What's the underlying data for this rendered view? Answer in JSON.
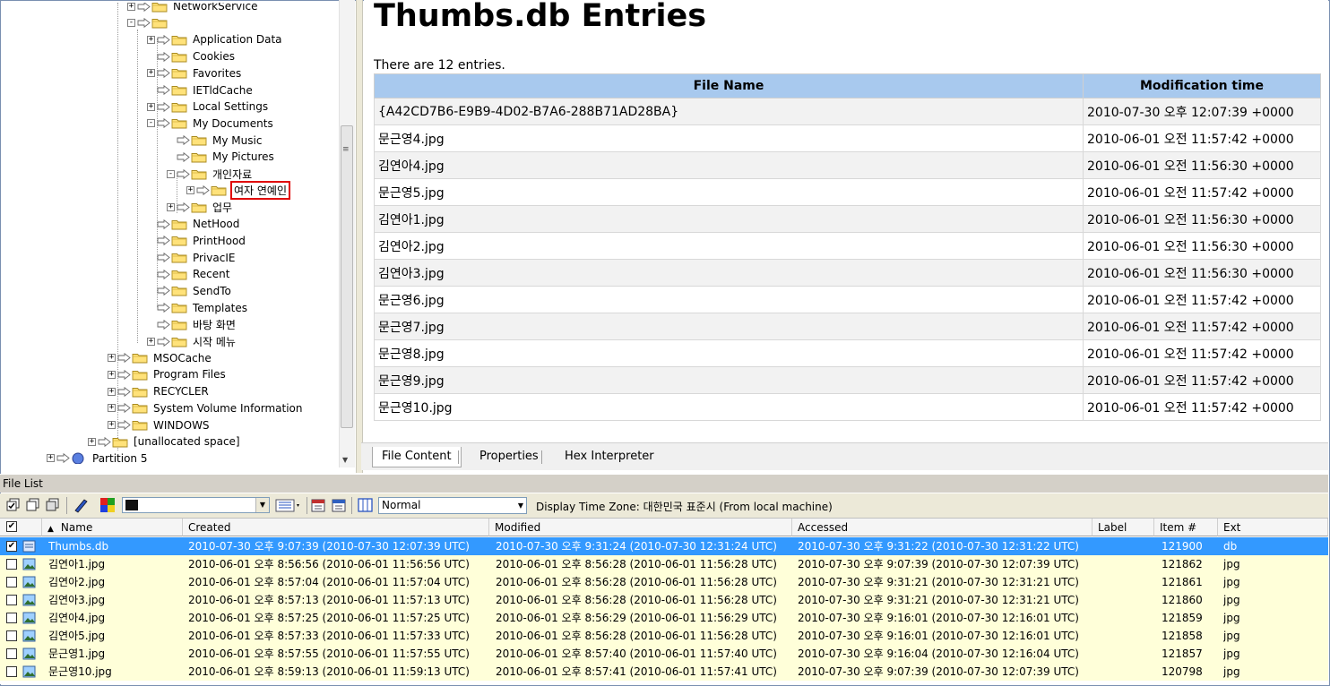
{
  "tree": {
    "items": [
      {
        "label": "NetworkService",
        "indent": 0,
        "expander": "+"
      },
      {
        "label": "",
        "indent": 0,
        "expander": "-"
      },
      {
        "label": "Application Data",
        "indent": 1,
        "expander": "+"
      },
      {
        "label": "Cookies",
        "indent": 1,
        "expander": ""
      },
      {
        "label": "Favorites",
        "indent": 1,
        "expander": "+"
      },
      {
        "label": "IETldCache",
        "indent": 1,
        "expander": ""
      },
      {
        "label": "Local Settings",
        "indent": 1,
        "expander": "+"
      },
      {
        "label": "My Documents",
        "indent": 1,
        "expander": "-"
      },
      {
        "label": "My Music",
        "indent": 2,
        "expander": ""
      },
      {
        "label": "My Pictures",
        "indent": 2,
        "expander": ""
      },
      {
        "label": "개인자료",
        "indent": 2,
        "expander": "-"
      },
      {
        "label": "여자 연예인",
        "indent": 3,
        "expander": "+",
        "selected": true
      },
      {
        "label": "업무",
        "indent": 2,
        "expander": "+"
      },
      {
        "label": "NetHood",
        "indent": 1,
        "expander": ""
      },
      {
        "label": "PrintHood",
        "indent": 1,
        "expander": ""
      },
      {
        "label": "PrivacIE",
        "indent": 1,
        "expander": ""
      },
      {
        "label": "Recent",
        "indent": 1,
        "expander": ""
      },
      {
        "label": "SendTo",
        "indent": 1,
        "expander": ""
      },
      {
        "label": "Templates",
        "indent": 1,
        "expander": ""
      },
      {
        "label": "바탕 화면",
        "indent": 1,
        "expander": ""
      },
      {
        "label": "시작 메뉴",
        "indent": 1,
        "expander": "+"
      },
      {
        "label": "MSOCache",
        "indent": -1,
        "expander": "+"
      },
      {
        "label": "Program Files",
        "indent": -1,
        "expander": "+"
      },
      {
        "label": "RECYCLER",
        "indent": -1,
        "expander": "+"
      },
      {
        "label": "System Volume Information",
        "indent": -1,
        "expander": "+"
      },
      {
        "label": "WINDOWS",
        "indent": -1,
        "expander": "+"
      },
      {
        "label": "[unallocated space]",
        "indent": -2,
        "expander": "+"
      },
      {
        "label": "Partition 5",
        "indent": -4,
        "expander": "+"
      }
    ]
  },
  "report": {
    "title": "Thumbs.db Entries",
    "count_text": "There are 12 entries.",
    "columns": [
      "File Name",
      "Modification time"
    ],
    "rows": [
      [
        "{A42CD7B6-E9B9-4D02-B7A6-288B71AD28BA}",
        "2010-07-30 오후 12:07:39 +0000"
      ],
      [
        "문근영4.jpg",
        "2010-06-01 오전 11:57:42 +0000"
      ],
      [
        "김연아4.jpg",
        "2010-06-01 오전 11:56:30 +0000"
      ],
      [
        "문근영5.jpg",
        "2010-06-01 오전 11:57:42 +0000"
      ],
      [
        "김연아1.jpg",
        "2010-06-01 오전 11:56:30 +0000"
      ],
      [
        "김연아2.jpg",
        "2010-06-01 오전 11:56:30 +0000"
      ],
      [
        "김연아3.jpg",
        "2010-06-01 오전 11:56:30 +0000"
      ],
      [
        "문근영6.jpg",
        "2010-06-01 오전 11:57:42 +0000"
      ],
      [
        "문근영7.jpg",
        "2010-06-01 오전 11:57:42 +0000"
      ],
      [
        "문근영8.jpg",
        "2010-06-01 오전 11:57:42 +0000"
      ],
      [
        "문근영9.jpg",
        "2010-06-01 오전 11:57:42 +0000"
      ],
      [
        "문근영10.jpg",
        "2010-06-01 오전 11:57:42 +0000"
      ]
    ]
  },
  "tabs": [
    "File Content",
    "Properties",
    "Hex Interpreter"
  ],
  "file_list": {
    "title": "File List",
    "mode": "Normal",
    "timezone": "Display Time Zone: 대한민국 표준시  (From local machine)",
    "columns": [
      "",
      "Name",
      "Created",
      "Modified",
      "Accessed",
      "Label",
      "Item #",
      "Ext"
    ],
    "rows": [
      {
        "checked": true,
        "selected": true,
        "name": "Thumbs.db",
        "created": "2010-07-30 오후 9:07:39 (2010-07-30 12:07:39 UTC)",
        "modified": "2010-07-30 오후 9:31:24 (2010-07-30 12:31:24 UTC)",
        "accessed": "2010-07-30 오후 9:31:22 (2010-07-30 12:31:22 UTC)",
        "label": "",
        "item": "121900",
        "ext": "db"
      },
      {
        "checked": false,
        "selected": false,
        "name": "김연아1.jpg",
        "created": "2010-06-01 오후 8:56:56 (2010-06-01 11:56:56 UTC)",
        "modified": "2010-06-01 오후 8:56:28 (2010-06-01 11:56:28 UTC)",
        "accessed": "2010-07-30 오후 9:07:39 (2010-07-30 12:07:39 UTC)",
        "label": "",
        "item": "121862",
        "ext": "jpg"
      },
      {
        "checked": false,
        "selected": false,
        "name": "김연아2.jpg",
        "created": "2010-06-01 오후 8:57:04 (2010-06-01 11:57:04 UTC)",
        "modified": "2010-06-01 오후 8:56:28 (2010-06-01 11:56:28 UTC)",
        "accessed": "2010-07-30 오후 9:31:21 (2010-07-30 12:31:21 UTC)",
        "label": "",
        "item": "121861",
        "ext": "jpg"
      },
      {
        "checked": false,
        "selected": false,
        "name": "김연아3.jpg",
        "created": "2010-06-01 오후 8:57:13 (2010-06-01 11:57:13 UTC)",
        "modified": "2010-06-01 오후 8:56:28 (2010-06-01 11:56:28 UTC)",
        "accessed": "2010-07-30 오후 9:31:21 (2010-07-30 12:31:21 UTC)",
        "label": "",
        "item": "121860",
        "ext": "jpg"
      },
      {
        "checked": false,
        "selected": false,
        "name": "김연아4.jpg",
        "created": "2010-06-01 오후 8:57:25 (2010-06-01 11:57:25 UTC)",
        "modified": "2010-06-01 오후 8:56:29 (2010-06-01 11:56:29 UTC)",
        "accessed": "2010-07-30 오후 9:16:01 (2010-07-30 12:16:01 UTC)",
        "label": "",
        "item": "121859",
        "ext": "jpg"
      },
      {
        "checked": false,
        "selected": false,
        "name": "김연아5.jpg",
        "created": "2010-06-01 오후 8:57:33 (2010-06-01 11:57:33 UTC)",
        "modified": "2010-06-01 오후 8:56:28 (2010-06-01 11:56:28 UTC)",
        "accessed": "2010-07-30 오후 9:16:01 (2010-07-30 12:16:01 UTC)",
        "label": "",
        "item": "121858",
        "ext": "jpg"
      },
      {
        "checked": false,
        "selected": false,
        "name": "문근영1.jpg",
        "created": "2010-06-01 오후 8:57:55 (2010-06-01 11:57:55 UTC)",
        "modified": "2010-06-01 오후 8:57:40 (2010-06-01 11:57:40 UTC)",
        "accessed": "2010-07-30 오후 9:16:04 (2010-07-30 12:16:04 UTC)",
        "label": "",
        "item": "121857",
        "ext": "jpg"
      },
      {
        "checked": false,
        "selected": false,
        "name": "문근영10.jpg",
        "created": "2010-06-01 오후 8:59:13 (2010-06-01 11:59:13 UTC)",
        "modified": "2010-06-01 오후 8:57:41 (2010-06-01 11:57:41 UTC)",
        "accessed": "2010-07-30 오후 9:07:39 (2010-07-30 12:07:39 UTC)",
        "label": "",
        "item": "120798",
        "ext": "jpg"
      }
    ]
  },
  "colors": {
    "header_blue": "#a8c9ee",
    "selection": "#3399ff",
    "row_yellow": "#ffffd9",
    "highlight_red": "#e00000"
  }
}
